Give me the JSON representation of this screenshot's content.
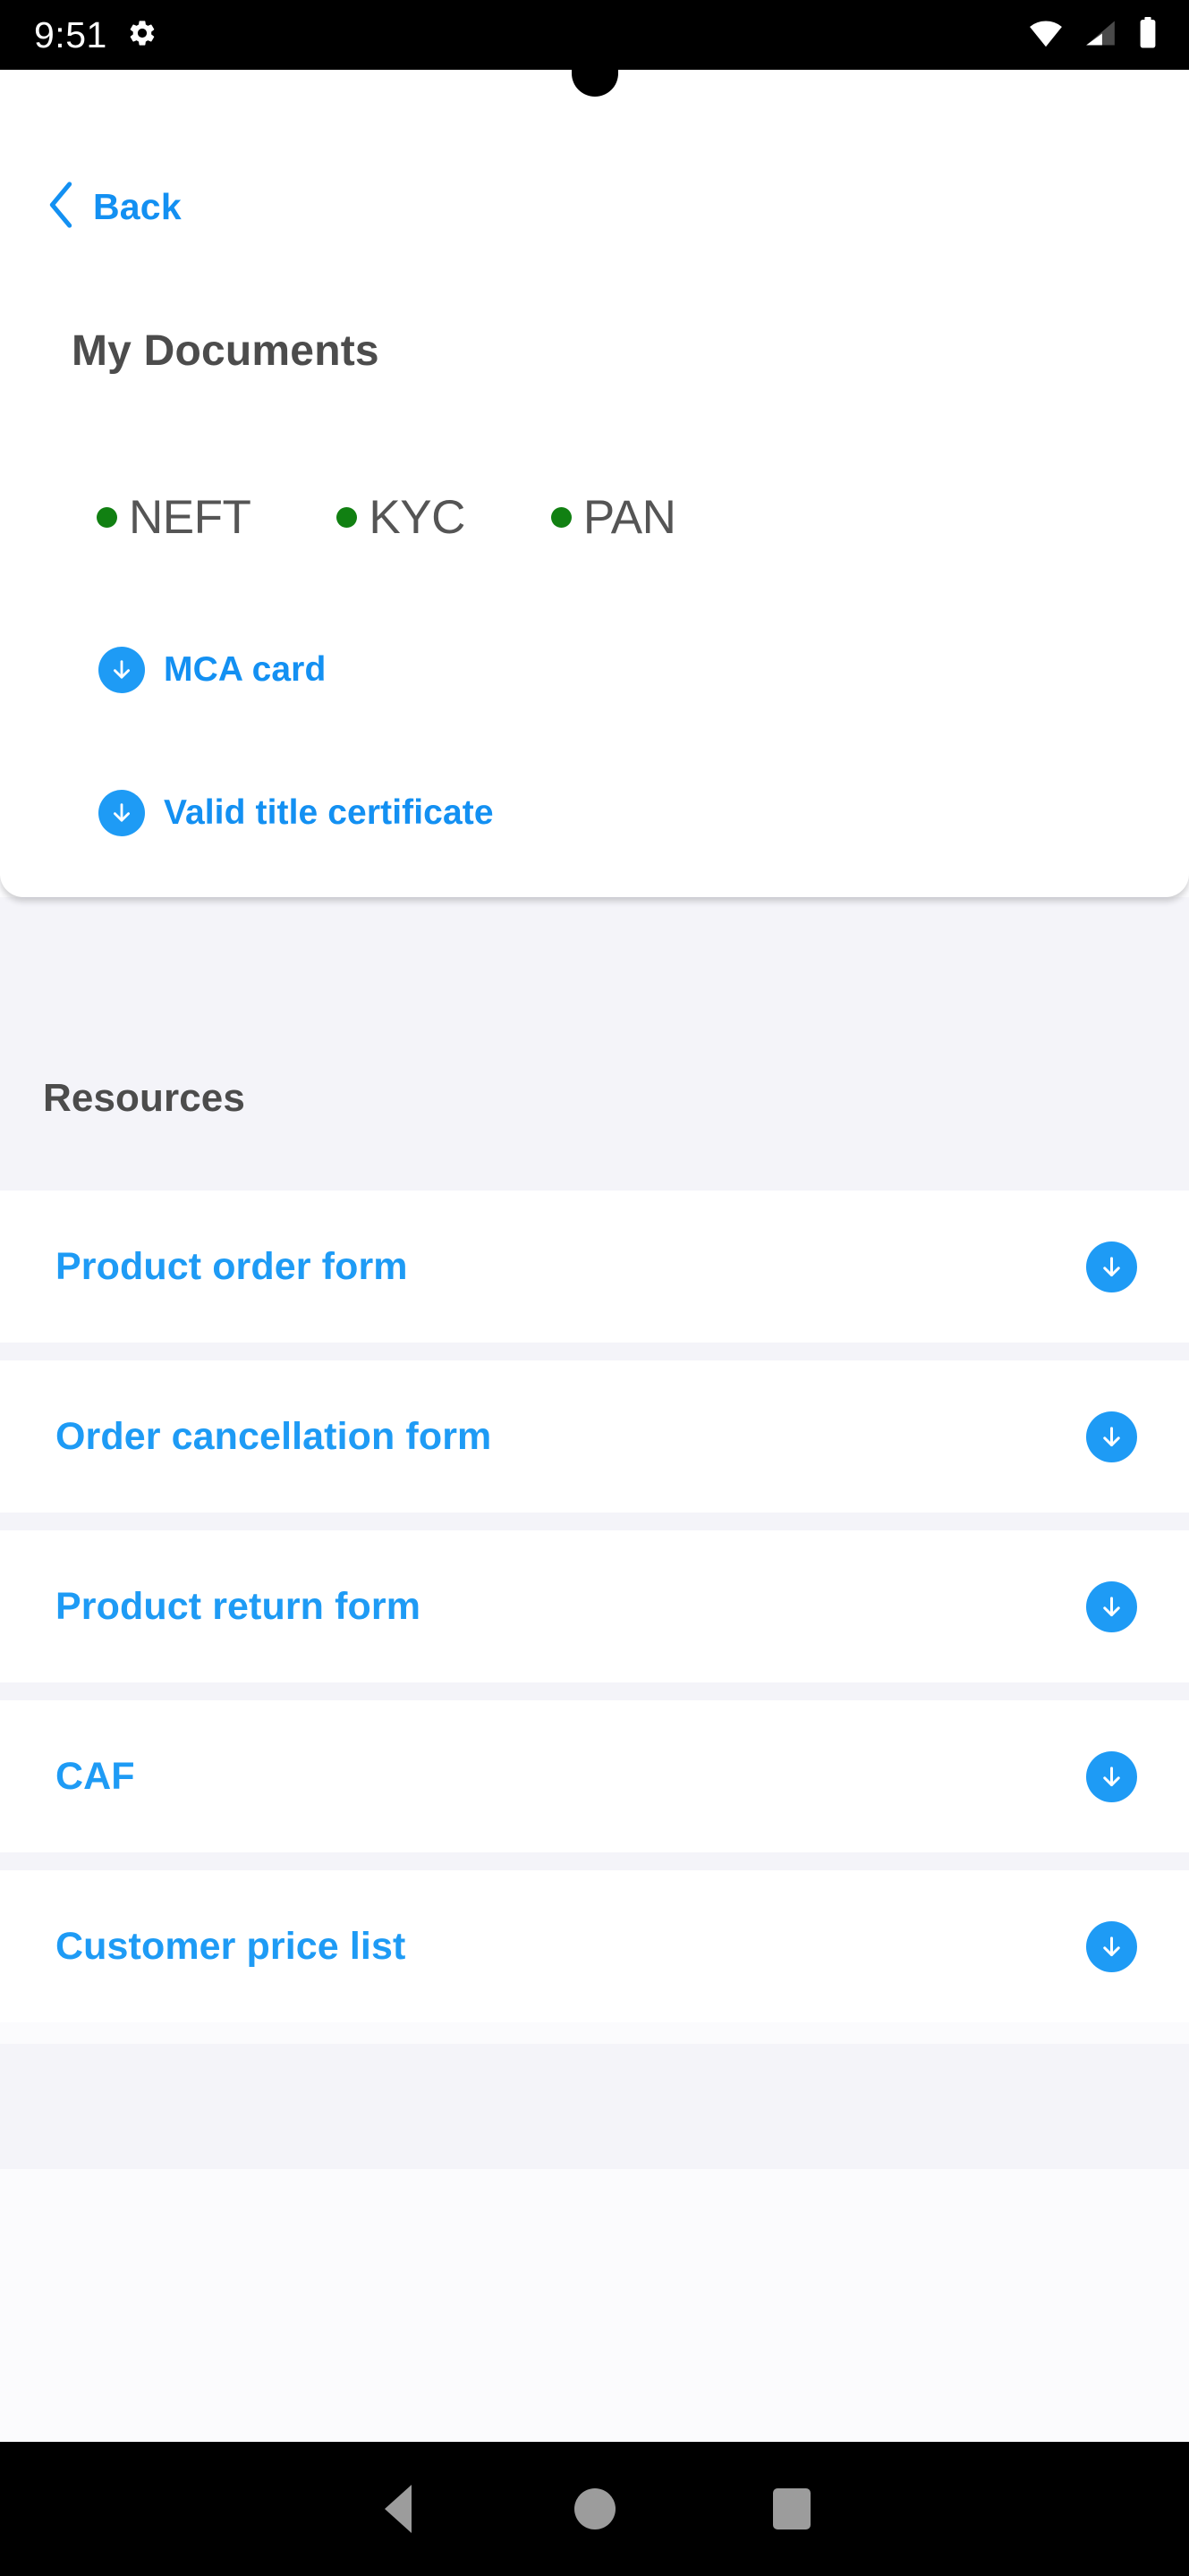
{
  "status_bar": {
    "time": "9:51",
    "left_icons": [
      "gear-icon"
    ],
    "right_icons": [
      "wifi-icon",
      "cellular-signal-icon",
      "battery-icon"
    ],
    "battery_level": "full",
    "wifi_level": "full",
    "signal_level": "2-of-4"
  },
  "nav": {
    "back_label": "Back",
    "back_icon": "chevron-left-icon"
  },
  "documents_card": {
    "title": "My Documents",
    "statuses": [
      {
        "label": "NEFT",
        "state": "verified",
        "dot_color": "#118012"
      },
      {
        "label": "KYC",
        "state": "verified",
        "dot_color": "#118012"
      },
      {
        "label": "PAN",
        "state": "verified",
        "dot_color": "#118012"
      }
    ],
    "downloads": [
      {
        "label": "MCA card",
        "icon": "download-circle-icon"
      },
      {
        "label": "Valid title certificate",
        "icon": "download-circle-icon"
      }
    ]
  },
  "resources": {
    "heading": "Resources",
    "items": [
      {
        "label": "Product order form",
        "icon": "download-circle-icon"
      },
      {
        "label": "Order cancellation form",
        "icon": "download-circle-icon"
      },
      {
        "label": "Product return form",
        "icon": "download-circle-icon"
      },
      {
        "label": "CAF",
        "icon": "download-circle-icon"
      },
      {
        "label": "Customer price list",
        "icon": "download-circle-icon"
      }
    ]
  },
  "system_nav": {
    "back": "back-triangle-icon",
    "home": "home-circle-icon",
    "recents": "recents-square-icon"
  },
  "colors": {
    "accent_blue": "#1e9bf5",
    "link_blue": "#1390f2",
    "verified_green": "#118012",
    "heading_gray": "#4c4c4c",
    "page_background": "#f4f4f9",
    "card_background": "#ffffff",
    "system_bar": "#000000"
  }
}
